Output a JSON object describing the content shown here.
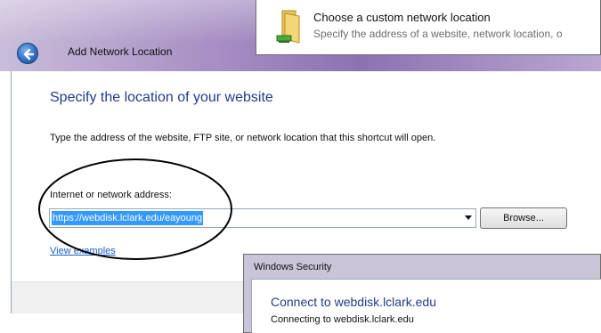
{
  "wizard": {
    "title": "Add Network Location",
    "heading": "Specify the location of your website",
    "instruction": "Type the address of the website, FTP site, or network location that this shortcut will open.",
    "address_label": "Internet or network address:",
    "address_value": "https://webdisk.lclark.edu/eayoung",
    "browse_label": "Browse...",
    "examples_link": "View examples"
  },
  "popup": {
    "title": "Choose a custom network location",
    "subtitle": "Specify the address of a website, network location, o"
  },
  "security_dialog": {
    "title": "Windows Security",
    "heading": "Connect to webdisk.lclark.edu",
    "status": "Connecting to webdisk.lclark.edu"
  },
  "icons": {
    "back": "back-arrow-icon",
    "popup": "network-folder-icon"
  },
  "colors": {
    "heading_blue": "#1f3d8a",
    "link_blue": "#1a5dc9",
    "selection_blue": "#3399ff",
    "title_bar_purple": "#8c72b0"
  }
}
